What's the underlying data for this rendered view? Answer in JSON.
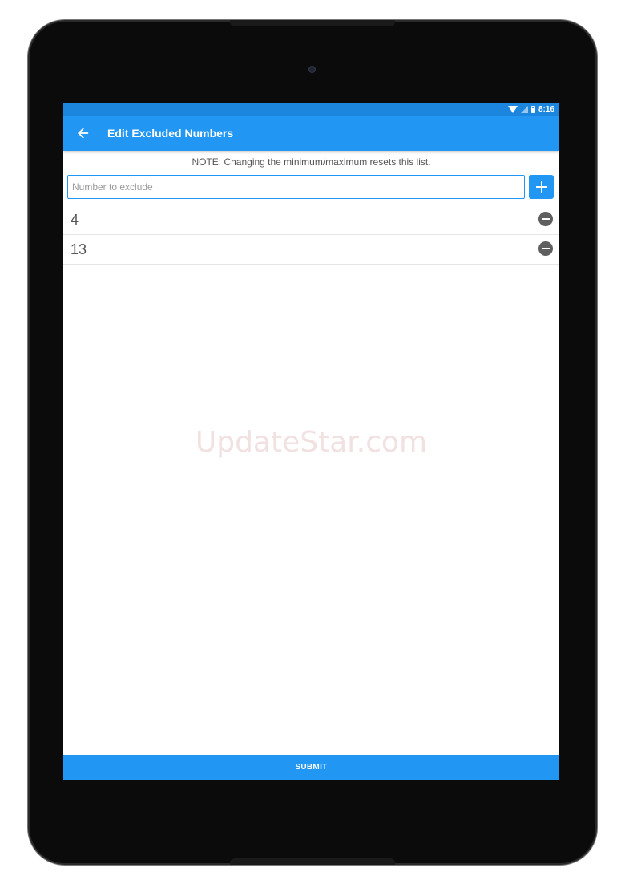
{
  "status_bar": {
    "time": "8:16"
  },
  "app_bar": {
    "title": "Edit Excluded Numbers",
    "back_icon": "arrow-left-icon"
  },
  "note": "NOTE: Changing the minimum/maximum resets this list.",
  "input": {
    "value": "",
    "placeholder": "Number to exclude",
    "add_icon": "plus-icon"
  },
  "excluded_numbers": [
    {
      "value": "4",
      "remove_icon": "minus-circle-icon"
    },
    {
      "value": "13",
      "remove_icon": "minus-circle-icon"
    }
  ],
  "watermark": "UpdateStar.com",
  "submit_label": "SUBMIT",
  "colors": {
    "primary": "#2196f3",
    "status_bar": "#1c86df",
    "remove_icon": "#5f5f5f"
  }
}
